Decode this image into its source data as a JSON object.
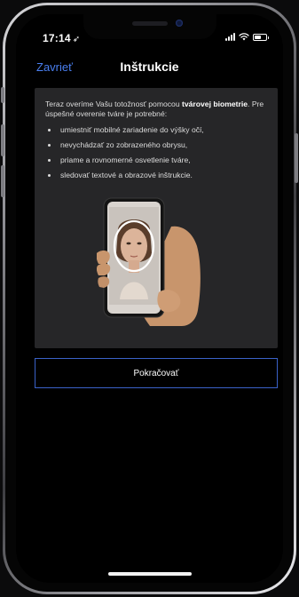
{
  "status_bar": {
    "time": "17:14",
    "location_arrow": "➶",
    "battery_level": 0.55
  },
  "nav": {
    "close_label": "Zavrieť",
    "title": "Inštrukcie"
  },
  "instructions": {
    "intro_before": "Teraz overíme Vašu totožnosť pomocou ",
    "intro_bold": "tvárovej biometrie",
    "intro_after": ". Pre úspešné overenie tváre je potrebné:",
    "items": [
      "umiestniť mobilné zariadenie do výšky očí,",
      "nevychádzať zo zobrazeného obrysu,",
      "priame a rovnomerné osvetlenie tváre,",
      "sledovať textové a obrazové inštrukcie."
    ]
  },
  "continue_button": {
    "label": "Pokračovať"
  },
  "colors": {
    "accent": "#4a7ff0",
    "button_border": "#3a62c8",
    "card_background": "#262628"
  }
}
